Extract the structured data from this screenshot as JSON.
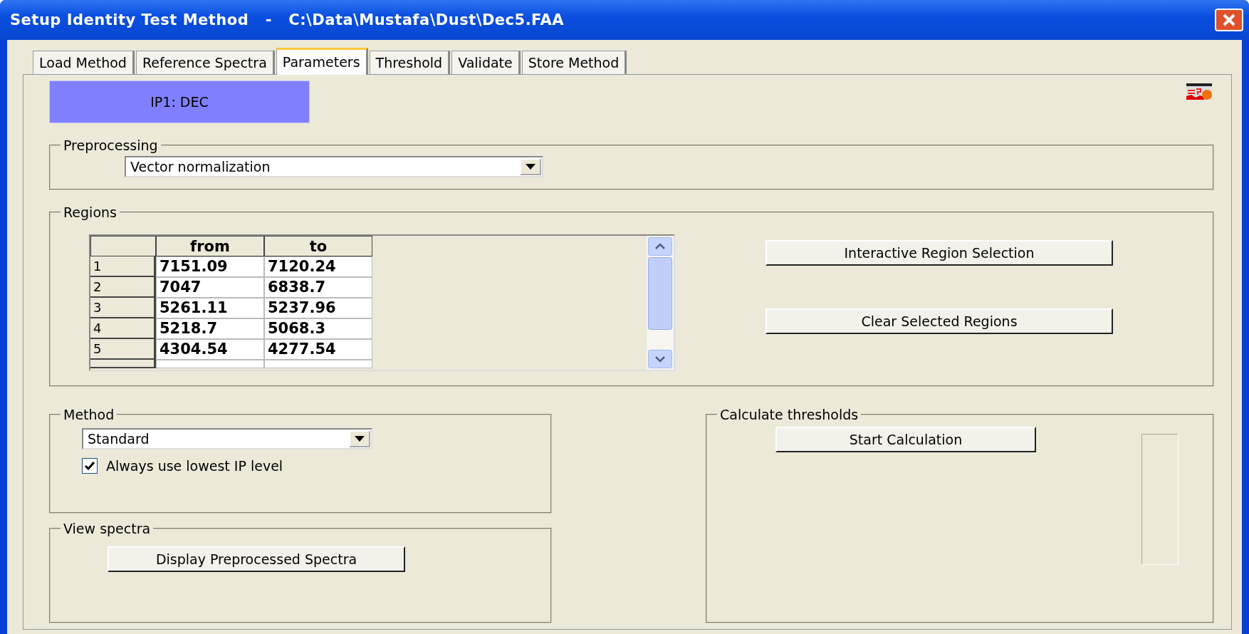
{
  "window": {
    "title": "Setup Identity Test Method   -   C:\\Data\\Mustafa\\Dust\\Dec5.FAA"
  },
  "tabs": [
    {
      "label": "Load Method",
      "selected": false
    },
    {
      "label": "Reference Spectra",
      "selected": false
    },
    {
      "label": "Parameters",
      "selected": true
    },
    {
      "label": "Threshold",
      "selected": false
    },
    {
      "label": "Validate",
      "selected": false
    },
    {
      "label": "Store Method",
      "selected": false
    }
  ],
  "header_label": "IP1: DEC",
  "preprocessing": {
    "title": "Preprocessing",
    "value": "Vector normalization"
  },
  "regions": {
    "title": "Regions",
    "columns": [
      "from",
      "to"
    ],
    "rows": [
      {
        "index": "1",
        "cells": [
          "7151.09",
          "7120.24"
        ]
      },
      {
        "index": "2",
        "cells": [
          "7047",
          "6838.7"
        ]
      },
      {
        "index": "3",
        "cells": [
          "5261.11",
          "5237.96"
        ]
      },
      {
        "index": "4",
        "cells": [
          "5218.7",
          "5068.3"
        ]
      },
      {
        "index": "5",
        "cells": [
          "4304.54",
          "4277.54"
        ]
      }
    ],
    "buttons": [
      "Interactive Region Selection",
      "Clear Selected Regions"
    ]
  },
  "method": {
    "title": "Method",
    "value": "Standard",
    "checkbox": {
      "label": "Always use lowest IP level",
      "checked": true
    }
  },
  "view_spectra": {
    "title": "View spectra",
    "button": "Display Preprocessed Spectra"
  },
  "calculate": {
    "title": "Calculate thresholds",
    "button": "Start Calculation"
  }
}
